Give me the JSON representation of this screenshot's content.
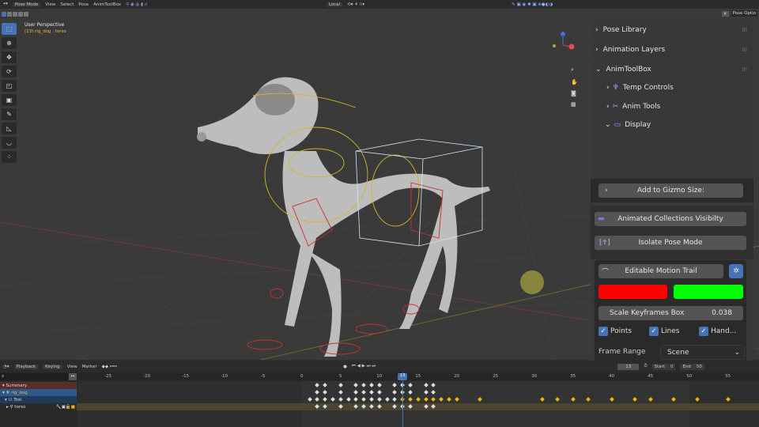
{
  "header": {
    "editor_icon": "pose-icon",
    "mode": "Pose Mode",
    "menus": [
      "View",
      "Select",
      "Pose",
      "AnimToolBox"
    ],
    "orientation": "Local",
    "pose_options": "Pose Optio"
  },
  "viewport": {
    "title": "User Perspective",
    "subtitle": "(13) rig_dog : torso"
  },
  "toolbar": {
    "tools": [
      "select-box-icon",
      "cursor-icon",
      "move-icon",
      "rotate-icon",
      "scale-icon",
      "transform-icon",
      "annotate-icon",
      "measure-icon",
      "relax-icon",
      "push-pose-icon"
    ]
  },
  "npanel": {
    "panels": [
      "Pose Library",
      "Animation Layers",
      "AnimToolBox"
    ],
    "subpanels": [
      "Temp Controls",
      "Anim Tools",
      "Display"
    ],
    "add_gizmo": "Add to Gizmo Size:",
    "anim_coll": "Animated Collections Visibilty",
    "isolate": "Isolate Pose Mode",
    "motion_trail": "Editable Motion Trail",
    "colors": {
      "a": "#ff0000",
      "b": "#00ff00"
    },
    "scale_label": "Scale Keyframes Box",
    "scale_value": "0.038",
    "checks": [
      {
        "label": "Points",
        "checked": true
      },
      {
        "label": "Lines",
        "checked": true
      },
      {
        "label": "Hand...",
        "checked": true
      }
    ],
    "frame_range_label": "Frame Range",
    "frame_range_value": "Scene"
  },
  "timeline": {
    "menus": [
      "Playback",
      "Keying",
      "View",
      "Marker"
    ],
    "current_frame": "13",
    "start_label": "Start",
    "start": "0",
    "end_label": "End",
    "end": "50",
    "ticks": [
      -25,
      -20,
      -15,
      -10,
      -5,
      0,
      5,
      10,
      15,
      20,
      25,
      30,
      35,
      40,
      45,
      50,
      55
    ],
    "channels": [
      "Summary",
      "rig_dog",
      "Trot",
      "torso"
    ],
    "white_keys": [
      2,
      3,
      5,
      7,
      8,
      9,
      10,
      12,
      13,
      14,
      16,
      17
    ],
    "trot_keys": [
      1,
      2,
      3,
      4,
      5,
      6,
      7,
      8,
      9,
      10,
      11,
      12,
      13,
      14,
      15,
      16,
      17,
      18,
      19,
      20,
      23,
      31,
      33,
      35,
      37,
      40,
      43,
      45,
      48,
      51,
      55
    ],
    "frame": 13
  }
}
